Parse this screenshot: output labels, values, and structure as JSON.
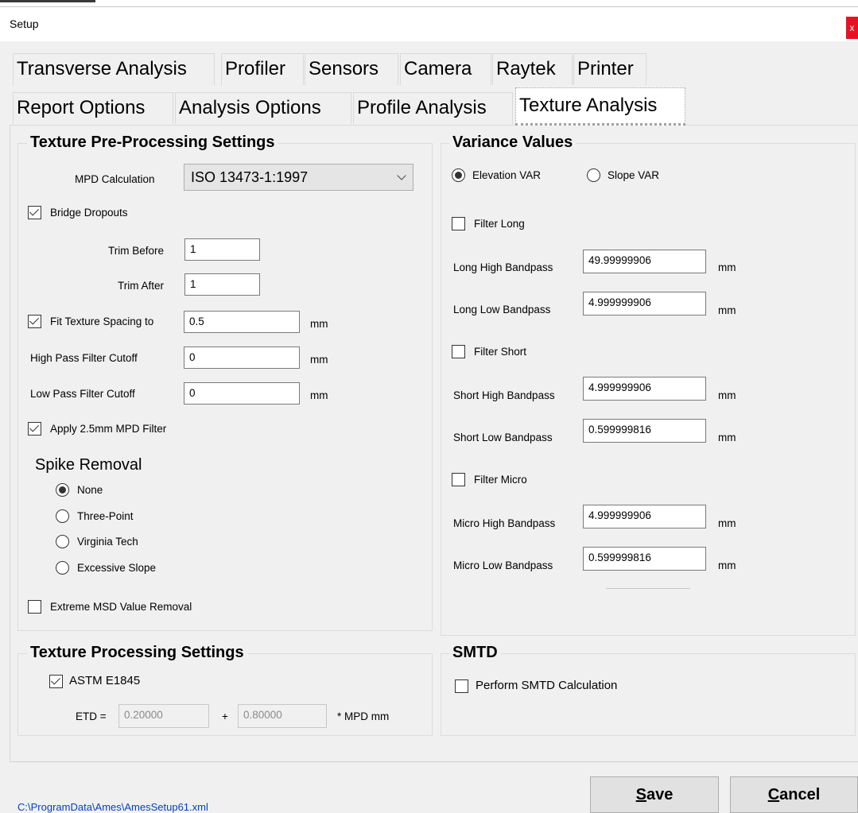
{
  "window": {
    "title": "Setup",
    "close_label": "x"
  },
  "tabs": {
    "row1": [
      "Transverse Analysis",
      "Profiler",
      "Sensors",
      "Camera",
      "Raytek",
      "Printer"
    ],
    "row2": [
      "Report Options",
      "Analysis Options",
      "Profile Analysis",
      "Texture Analysis"
    ],
    "active": "Texture Analysis"
  },
  "pre_processing": {
    "title": "Texture Pre-Processing Settings",
    "mpd_label": "MPD Calculation",
    "mpd_value": "ISO 13473-1:1997",
    "bridge_dropouts": {
      "label": "Bridge Dropouts",
      "checked": true
    },
    "trim_before": {
      "label": "Trim Before",
      "value": "1"
    },
    "trim_after": {
      "label": "Trim After",
      "value": "1"
    },
    "fit_spacing": {
      "label": "Fit Texture Spacing to",
      "checked": true,
      "value": "0.5",
      "unit": "mm"
    },
    "high_pass": {
      "label": "High Pass Filter Cutoff",
      "value": "0",
      "unit": "mm"
    },
    "low_pass": {
      "label": "Low Pass Filter Cutoff",
      "value": "0",
      "unit": "mm"
    },
    "apply_mpd": {
      "label": "Apply 2.5mm MPD Filter",
      "checked": true
    },
    "spike_title": "Spike Removal",
    "spike_options": [
      "None",
      "Three-Point",
      "Virginia Tech",
      "Excessive Slope"
    ],
    "spike_selected": "None",
    "extreme_msd": {
      "label": "Extreme MSD Value Removal",
      "checked": false
    }
  },
  "variance": {
    "title": "Variance Values",
    "elevation_label": "Elevation VAR",
    "slope_label": "Slope VAR",
    "selected": "Elevation VAR",
    "filter_long": {
      "label": "Filter Long",
      "checked": false
    },
    "long_high": {
      "label": "Long High Bandpass",
      "value": "49.99999906",
      "unit": "mm"
    },
    "long_low": {
      "label": "Long Low Bandpass",
      "value": "4.999999906",
      "unit": "mm"
    },
    "filter_short": {
      "label": "Filter Short",
      "checked": false
    },
    "short_high": {
      "label": "Short High Bandpass",
      "value": "4.999999906",
      "unit": "mm"
    },
    "short_low": {
      "label": "Short Low Bandpass",
      "value": "0.599999816",
      "unit": "mm"
    },
    "filter_micro": {
      "label": "Filter Micro",
      "checked": false
    },
    "micro_high": {
      "label": "Micro High Bandpass",
      "value": "4.999999906",
      "unit": "mm"
    },
    "micro_low": {
      "label": "Micro Low Bandpass",
      "value": "0.599999816",
      "unit": "mm"
    }
  },
  "processing": {
    "title": "Texture Processing Settings",
    "astm": {
      "label": "ASTM E1845",
      "checked": true
    },
    "etd_label": "ETD =",
    "etd_a": "0.20000",
    "plus": "+",
    "etd_b": "0.80000",
    "etd_suffix": "* MPD mm"
  },
  "smtd": {
    "title": "SMTD",
    "perform": {
      "label": "Perform SMTD Calculation",
      "checked": false
    }
  },
  "footer": {
    "path": "C:\\ProgramData\\Ames\\AmesSetup61.xml",
    "save_underline": "S",
    "save_rest": "ave",
    "cancel_underline": "C",
    "cancel_rest": "ancel"
  }
}
